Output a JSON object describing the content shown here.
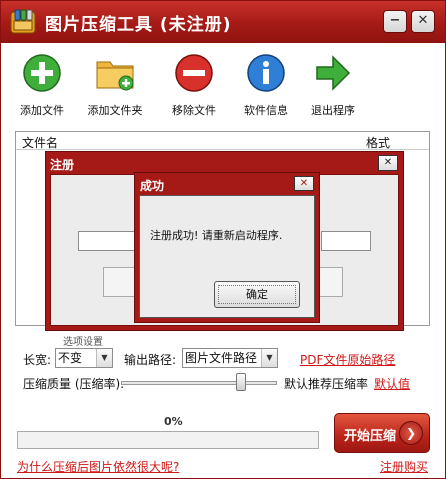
{
  "window": {
    "title": "图片压缩工具 (未注册)",
    "minimize_glyph": "−",
    "close_glyph": "✕",
    "accent_color": "#a51a16"
  },
  "toolbar": {
    "items": [
      {
        "label": "添加文件",
        "icon": "add-file-icon"
      },
      {
        "label": "添加文件夹",
        "icon": "add-folder-icon"
      },
      {
        "label": "移除文件",
        "icon": "remove-file-icon"
      },
      {
        "label": "软件信息",
        "icon": "info-icon"
      },
      {
        "label": "退出程序",
        "icon": "exit-icon"
      }
    ]
  },
  "file_list": {
    "columns": [
      "文件名",
      "格式"
    ]
  },
  "options": {
    "section_title": "选项设置",
    "size_label": "长宽:",
    "size_value": "不变",
    "output_label": "输出路径:",
    "output_value": "图片文件路径",
    "pdf_link": "PDF文件原始路径",
    "quality_label": "压缩质量 (压缩率):",
    "quality_hint": "默认推荐压缩率",
    "default_link": "默认值"
  },
  "progress": {
    "percent_text": "0%",
    "value": 0
  },
  "start_button": {
    "label": "开始压缩"
  },
  "footer": {
    "why_link": "为什么压缩后图片依然很大呢?",
    "buy_link": "注册购买"
  },
  "register_dialog": {
    "title": "注册",
    "close_glyph": "✕"
  },
  "message_box": {
    "title": "成功",
    "close_glyph": "✕",
    "message": "注册成功! 请重新启动程序.",
    "ok_label": "确定"
  }
}
